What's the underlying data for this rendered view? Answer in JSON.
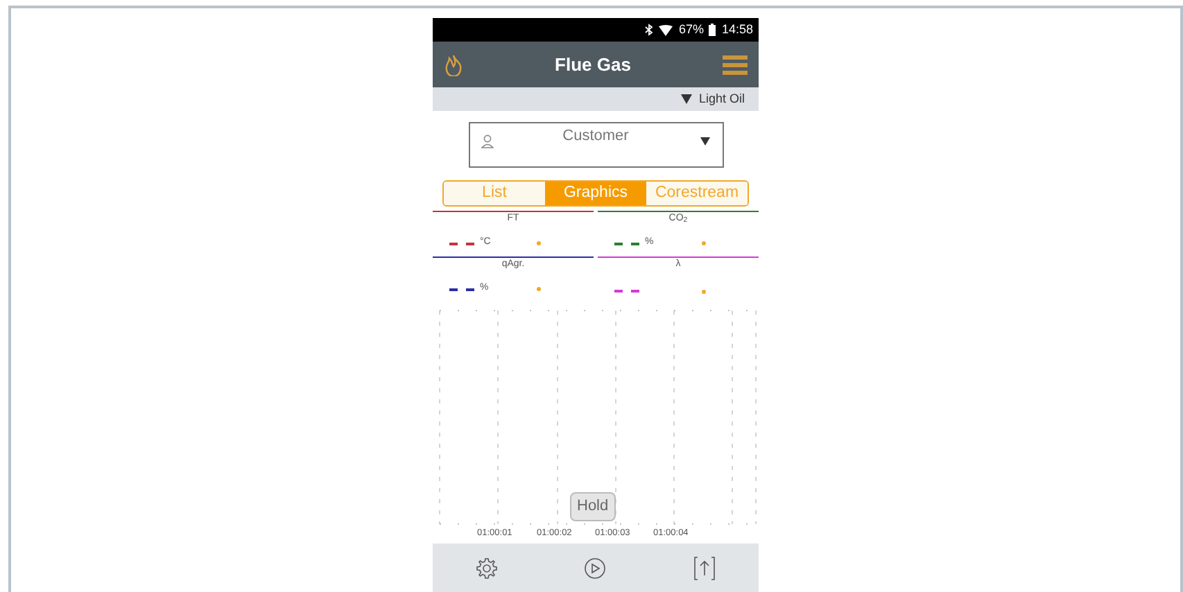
{
  "status_bar": {
    "battery": "67%",
    "time": "14:58"
  },
  "header": {
    "title": "Flue Gas"
  },
  "fuel": {
    "label": "Light Oil"
  },
  "customer": {
    "placeholder": "Customer"
  },
  "tabs": [
    {
      "label": "List",
      "selected": false
    },
    {
      "label": "Graphics",
      "selected": true
    },
    {
      "label": "Corestream",
      "selected": false
    }
  ],
  "legend": [
    {
      "name": "FT",
      "unit": "°C",
      "color": "#c8323c"
    },
    {
      "name": "CO$_{2}$",
      "unit": "%",
      "color": "#2e7d32"
    },
    {
      "name": "qAgr.",
      "unit": "%",
      "color": "#2c2ca8"
    },
    {
      "name": "λ",
      "color": "#d43ad4"
    }
  ],
  "chart": {
    "time_labels": [
      "01:00:01",
      "01:00:02",
      "01:00:03",
      "01:00:04"
    ],
    "hold_button": "Hold"
  }
}
